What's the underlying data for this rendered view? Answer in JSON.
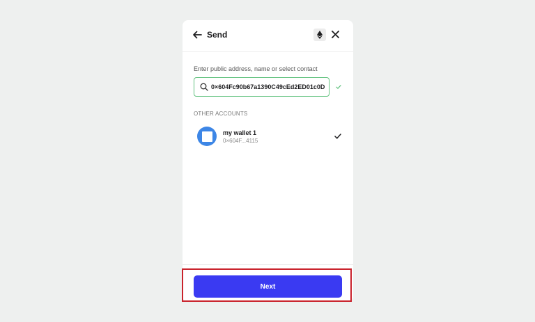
{
  "header": {
    "title": "Send",
    "back_icon": "arrow-left-icon",
    "network_icon": "ethereum-icon",
    "close_icon": "close-icon"
  },
  "recipient": {
    "label": "Enter public address, name or select contact",
    "value": "0×604Fc90b67a1390C49cEd2ED01c0D",
    "valid_icon": "check-valid-icon"
  },
  "other_accounts": {
    "label": "OTHER ACCOUNTS",
    "items": [
      {
        "name": "my wallet 1",
        "address": "0×604F...4115",
        "selected": true
      }
    ]
  },
  "footer": {
    "next_label": "Next"
  },
  "colors": {
    "accent": "#3a3af2",
    "valid_border": "#62c27f",
    "avatar": "#3d86e6",
    "highlight": "#c9222b",
    "background": "#eef0ef"
  }
}
